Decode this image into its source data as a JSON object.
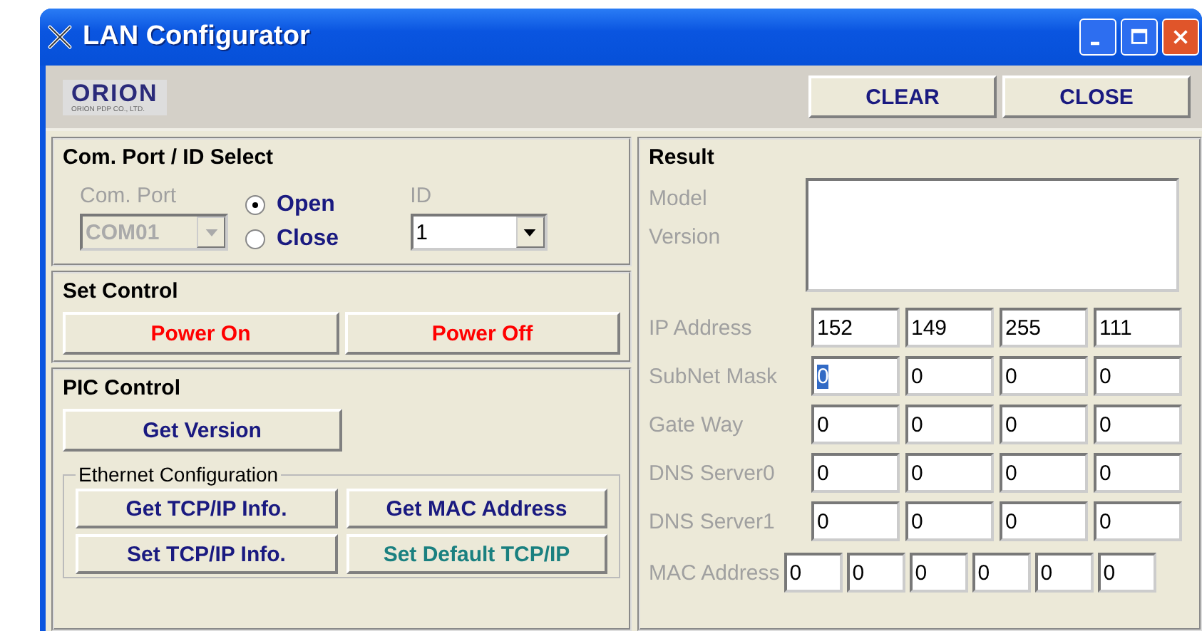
{
  "window": {
    "title": "LAN Configurator"
  },
  "logo": {
    "name": "ORION",
    "tagline": "ORION PDP CO., LTD."
  },
  "toolbar_buttons": [
    "CLEAR",
    "CLOSE"
  ],
  "com_port_section": {
    "title": "Com. Port / ID Select",
    "com_port_label": "Com. Port",
    "com_port": {
      "value": "COM01",
      "disabled": true
    },
    "radios": [
      {
        "label": "Open",
        "selected": true
      },
      {
        "label": "Close",
        "selected": false
      }
    ],
    "id_label": "ID",
    "id": {
      "value": "1",
      "disabled": false
    }
  },
  "set_control": {
    "title": "Set Control",
    "buttons": [
      {
        "label": "Power On",
        "color": "#ff0000"
      },
      {
        "label": "Power Off",
        "color": "#ff0000"
      }
    ]
  },
  "pic_control": {
    "title": "PIC Control",
    "button": {
      "label": "Get Version",
      "color": "#1a1a80"
    },
    "ethernet": {
      "title": "Ethernet Configuration",
      "buttons": [
        {
          "label": "Get TCP/IP Info.",
          "color": "#1a1a80"
        },
        {
          "label": "Get MAC Address",
          "color": "#1a1a80"
        },
        {
          "label": "Set TCP/IP Info.",
          "color": "#1a1a80"
        },
        {
          "label": "Set Default TCP/IP",
          "color": "#1a8080"
        }
      ]
    }
  },
  "result": {
    "title": "Result",
    "model_labels": [
      "Model",
      "Version"
    ],
    "rows": [
      {
        "label": "IP Address",
        "fields": [
          {
            "value": "152",
            "selected": false
          },
          {
            "value": "149",
            "selected": false
          },
          {
            "value": "255",
            "selected": false
          },
          {
            "value": "111",
            "selected": false
          }
        ]
      },
      {
        "label": "SubNet Mask",
        "fields": [
          {
            "value": "0",
            "selected": true
          },
          {
            "value": "0",
            "selected": false
          },
          {
            "value": "0",
            "selected": false
          },
          {
            "value": "0",
            "selected": false
          }
        ]
      },
      {
        "label": "Gate Way",
        "fields": [
          {
            "value": "0",
            "selected": false
          },
          {
            "value": "0",
            "selected": false
          },
          {
            "value": "0",
            "selected": false
          },
          {
            "value": "0",
            "selected": false
          }
        ]
      },
      {
        "label": "DNS Server0",
        "fields": [
          {
            "value": "0",
            "selected": false
          },
          {
            "value": "0",
            "selected": false
          },
          {
            "value": "0",
            "selected": false
          },
          {
            "value": "0",
            "selected": false
          }
        ]
      },
      {
        "label": "DNS Server1",
        "fields": [
          {
            "value": "0",
            "selected": false
          },
          {
            "value": "0",
            "selected": false
          },
          {
            "value": "0",
            "selected": false
          },
          {
            "value": "0",
            "selected": false
          }
        ]
      }
    ],
    "mac": {
      "label": "MAC Address",
      "fields": [
        "0",
        "0",
        "0",
        "0",
        "0",
        "0"
      ]
    }
  }
}
